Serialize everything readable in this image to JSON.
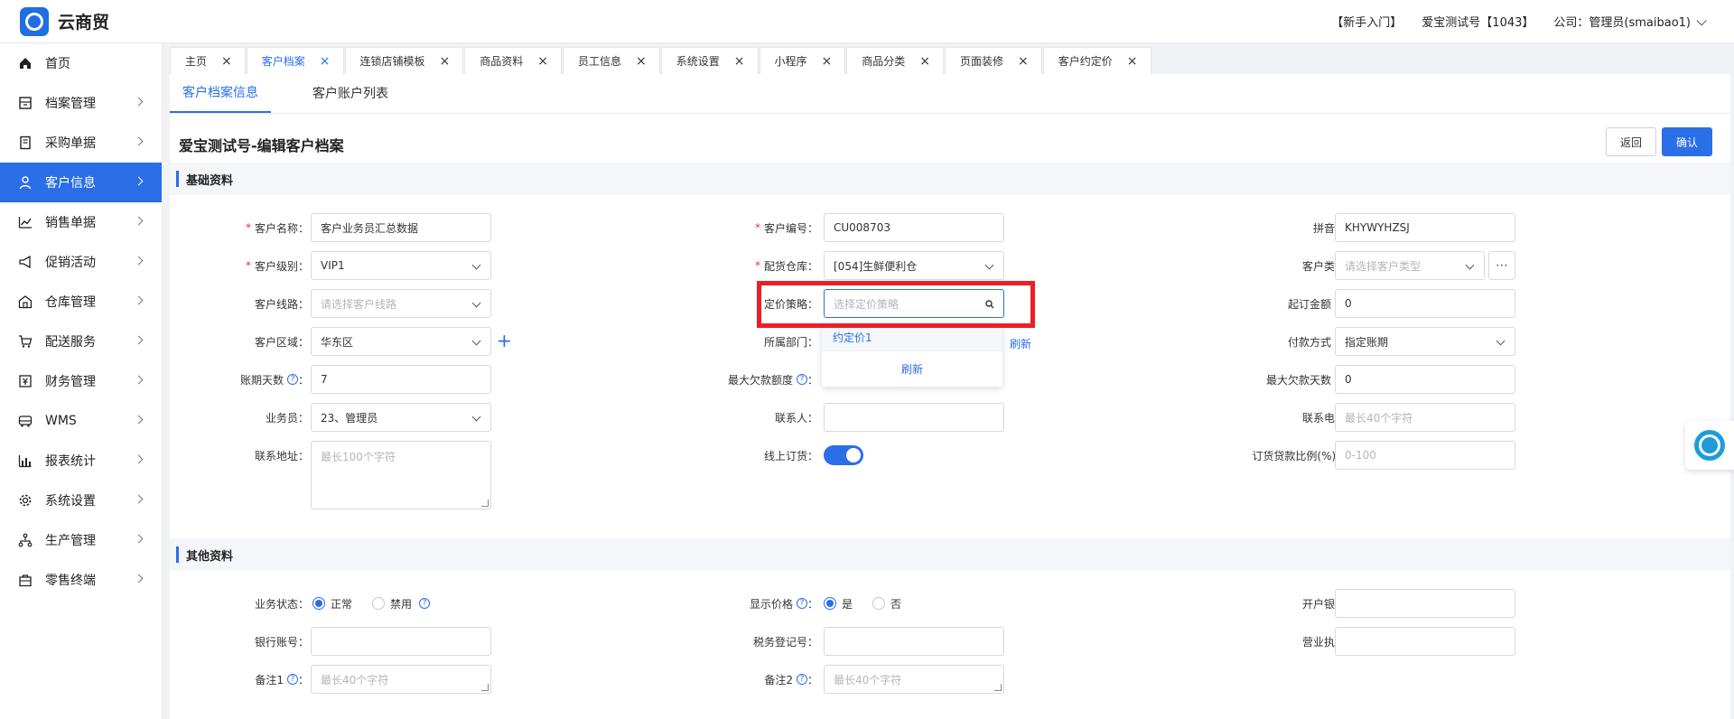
{
  "app": {
    "name": "云商贸"
  },
  "header": {
    "guide": "【新手入门】",
    "account": "爱宝测试号【1043】",
    "company": "公司：管理员(smaibao1)"
  },
  "sidebar": {
    "items": [
      {
        "label": "首页",
        "icon": "home-icon"
      },
      {
        "label": "档案管理",
        "icon": "archive-icon"
      },
      {
        "label": "采购单据",
        "icon": "receipt-icon"
      },
      {
        "label": "客户信息",
        "icon": "user-icon"
      },
      {
        "label": "销售单据",
        "icon": "chart-line-icon"
      },
      {
        "label": "促销活动",
        "icon": "megaphone-icon"
      },
      {
        "label": "仓库管理",
        "icon": "warehouse-icon"
      },
      {
        "label": "配送服务",
        "icon": "cart-icon"
      },
      {
        "label": "财务管理",
        "icon": "finance-icon"
      },
      {
        "label": "WMS",
        "icon": "truck-icon"
      },
      {
        "label": "报表统计",
        "icon": "bar-chart-icon"
      },
      {
        "label": "系统设置",
        "icon": "gear-icon"
      },
      {
        "label": "生产管理",
        "icon": "network-icon"
      },
      {
        "label": "零售终端",
        "icon": "bag-icon"
      }
    ]
  },
  "tabs": [
    "主页",
    "客户档案",
    "连锁店铺模板",
    "商品资料",
    "员工信息",
    "系统设置",
    "小程序",
    "商品分类",
    "页面装修",
    "客户约定价"
  ],
  "subtabs": [
    "客户档案信息",
    "客户账户列表"
  ],
  "page": {
    "title": "爱宝测试号-编辑客户档案",
    "back": "返回",
    "confirm": "确认"
  },
  "sections": {
    "basic": "基础资料",
    "other": "其他资料"
  },
  "form": {
    "customer_name": {
      "label": "客户名称：",
      "value": "客户业务员汇总数据"
    },
    "customer_no": {
      "label": "客户编号：",
      "value": "CU008703"
    },
    "pinyin": {
      "label": "拼音码：",
      "value": "KHYWYHZSJ"
    },
    "customer_level": {
      "label": "客户级别：",
      "value": "VIP1"
    },
    "warehouse": {
      "label": "配货仓库：",
      "value": "[054]生鲜便利仓"
    },
    "customer_type": {
      "label": "客户类型：",
      "placeholder": "请选择客户类型"
    },
    "route": {
      "label": "客户线路：",
      "placeholder": "请选择客户线路"
    },
    "pricing": {
      "label": "定价策略：",
      "placeholder": "选择定价策略"
    },
    "min_order": {
      "label": "起订金额",
      "value": "0"
    },
    "region": {
      "label": "客户区域：",
      "value": "华东区"
    },
    "department": {
      "label": "所属部门：",
      "refresh": "刷新"
    },
    "payment": {
      "label": "付款方式",
      "value": "指定账期"
    },
    "credit_days": {
      "label": "账期天数",
      "value": "7"
    },
    "max_debt": {
      "label": "最大欠款额度"
    },
    "max_debt_days": {
      "label": "最大欠款天数",
      "value": "0"
    },
    "salesman": {
      "label": "业务员：",
      "value": "23、管理员"
    },
    "contact": {
      "label": "联系人："
    },
    "phone": {
      "label": "联系电话：",
      "placeholder": "最长40个字符"
    },
    "address": {
      "label": "联系地址：",
      "placeholder": "最长100个字符"
    },
    "online_order": {
      "label": "线上订货："
    },
    "deposit_ratio": {
      "label": "订货贷款比例(%)",
      "placeholder": "0-100"
    }
  },
  "other": {
    "status": {
      "label": "业务状态：",
      "opt1": "正常",
      "opt2": "禁用"
    },
    "show_price": {
      "label": "显示价格",
      "opt1": "是",
      "opt2": "否"
    },
    "bank": {
      "label": "开户银行："
    },
    "bank_account": {
      "label": "银行账号："
    },
    "tax_no": {
      "label": "税务登记号："
    },
    "license": {
      "label": "营业执照："
    },
    "remark1": {
      "label": "备注1",
      "placeholder": "最长40个字符"
    },
    "remark2": {
      "label": "备注2",
      "placeholder": "最长40个字符"
    }
  },
  "dropdown": {
    "option": "约定价1",
    "refresh": "刷新"
  },
  "colors": {
    "accent": "#2a6ee8",
    "highlight": "#ee1e27"
  }
}
